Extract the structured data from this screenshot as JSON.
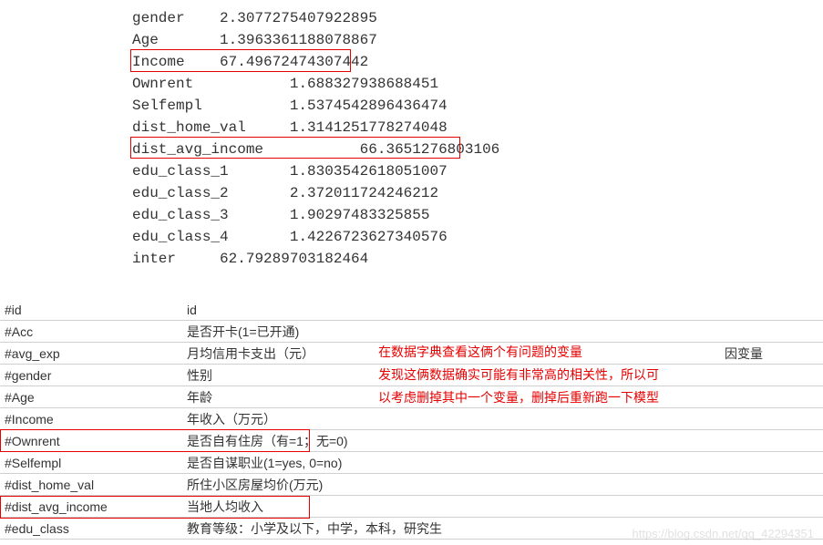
{
  "vif": {
    "gender": {
      "label": "gender",
      "value": "2.3077275407922895"
    },
    "age": {
      "label": "Age",
      "value": "1.3963361188078867"
    },
    "income": {
      "label": "Income",
      "value": "67.49672474307442"
    },
    "ownrent": {
      "label": "Ownrent",
      "value": "1.688327938688451"
    },
    "selfempl": {
      "label": "Selfempl",
      "value": "1.5374542896436474"
    },
    "dist_home_val": {
      "label": "dist_home_val",
      "value": "1.3141251778274048"
    },
    "dist_avg_income": {
      "label": "dist_avg_income",
      "value": "66.3651276803106"
    },
    "edu_class_1": {
      "label": "edu_class_1",
      "value": "1.8303542618051007"
    },
    "edu_class_2": {
      "label": "edu_class_2",
      "value": "2.372011724246212"
    },
    "edu_class_3": {
      "label": "edu_class_3",
      "value": "1.90297483325855"
    },
    "edu_class_4": {
      "label": "edu_class_4",
      "value": "1.4226723627340576"
    },
    "inter": {
      "label": "inter",
      "value": "62.79289703182464"
    }
  },
  "dict": [
    {
      "key": "#id",
      "desc": "id",
      "extra": ""
    },
    {
      "key": "#Acc",
      "desc": "是否开卡(1=已开通)",
      "extra": ""
    },
    {
      "key": "#avg_exp",
      "desc": "月均信用卡支出（元）",
      "extra": "因变量"
    },
    {
      "key": "#gender",
      "desc": "性别",
      "extra": ""
    },
    {
      "key": "#Age",
      "desc": "年龄",
      "extra": ""
    },
    {
      "key": "#Income",
      "desc": "年收入（万元）",
      "extra": ""
    },
    {
      "key": "#Ownrent",
      "desc": "是否自有住房（有=1；无=0)",
      "extra": ""
    },
    {
      "key": "#Selfempl",
      "desc": "是否自谋职业(1=yes, 0=no)",
      "extra": ""
    },
    {
      "key": "#dist_home_val",
      "desc": "所住小区房屋均价(万元)",
      "extra": ""
    },
    {
      "key": "#dist_avg_income",
      "desc": "当地人均收入",
      "extra": ""
    },
    {
      "key": "#edu_class",
      "desc": "教育等级：小学及以下，中学，本科，研究生",
      "extra": ""
    }
  ],
  "annotation": {
    "line1": "在数据字典查看这俩个有问题的变量",
    "line2": "发现这俩数据确实可能有非常高的相关性，所以可",
    "line3": "以考虑删掉其中一个变量，删掉后重新跑一下模型"
  },
  "watermark": "https://blog.csdn.net/qq_42294351"
}
